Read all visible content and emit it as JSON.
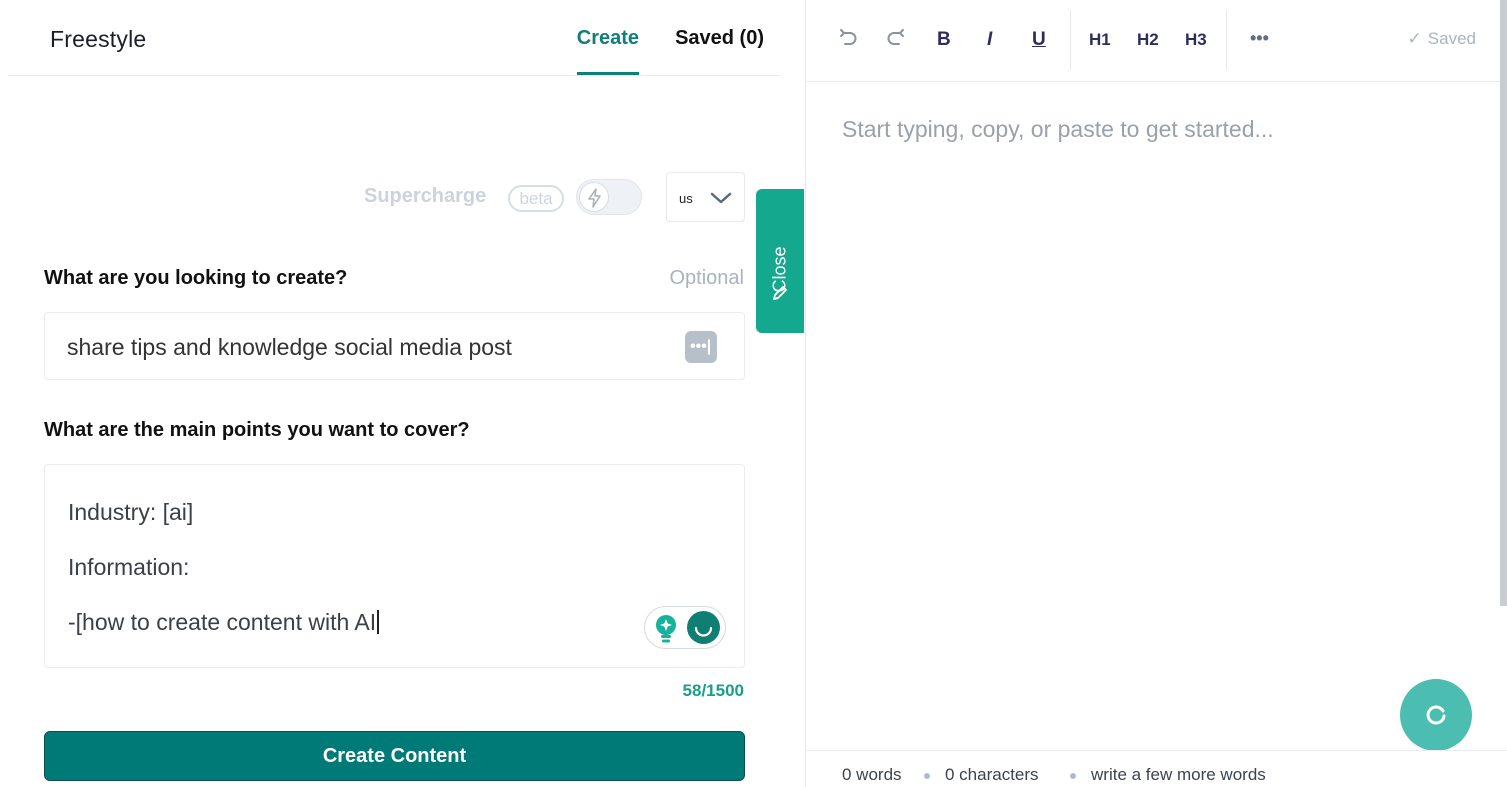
{
  "header": {
    "app_title": "Freestyle",
    "tabs": [
      {
        "label": "Create",
        "active": true
      },
      {
        "label": "Saved (0)",
        "active": false
      }
    ]
  },
  "options": {
    "supercharge_label": "Supercharge",
    "beta_badge": "beta",
    "supercharge_enabled": false,
    "language": "us"
  },
  "form": {
    "question1": "What are you looking to create?",
    "optional_label": "Optional",
    "question1_value": "share tips and knowledge social media post",
    "question2": "What are the main points you want to cover?",
    "question2_lines": [
      "Industry: [ai]",
      "Information:",
      "-[how to create content with AI"
    ],
    "char_counter": "58/1500",
    "submit_label": "Create Content"
  },
  "side_tab": {
    "close_label": "Close"
  },
  "editor": {
    "toolbar": {
      "bold": "B",
      "italic": "I",
      "underline": "U",
      "h1": "H1",
      "h2": "H2",
      "h3": "H3",
      "more": "•••",
      "saved_status": "Saved"
    },
    "placeholder": "Start typing, copy, or paste to get started...",
    "footer": {
      "words": "0 words",
      "characters": "0 characters",
      "hint": "write a few more words"
    }
  },
  "colors": {
    "accent": "#0f7f79",
    "side_tab": "#14a88f",
    "button": "#007a76",
    "fab": "#4bbeb1"
  }
}
